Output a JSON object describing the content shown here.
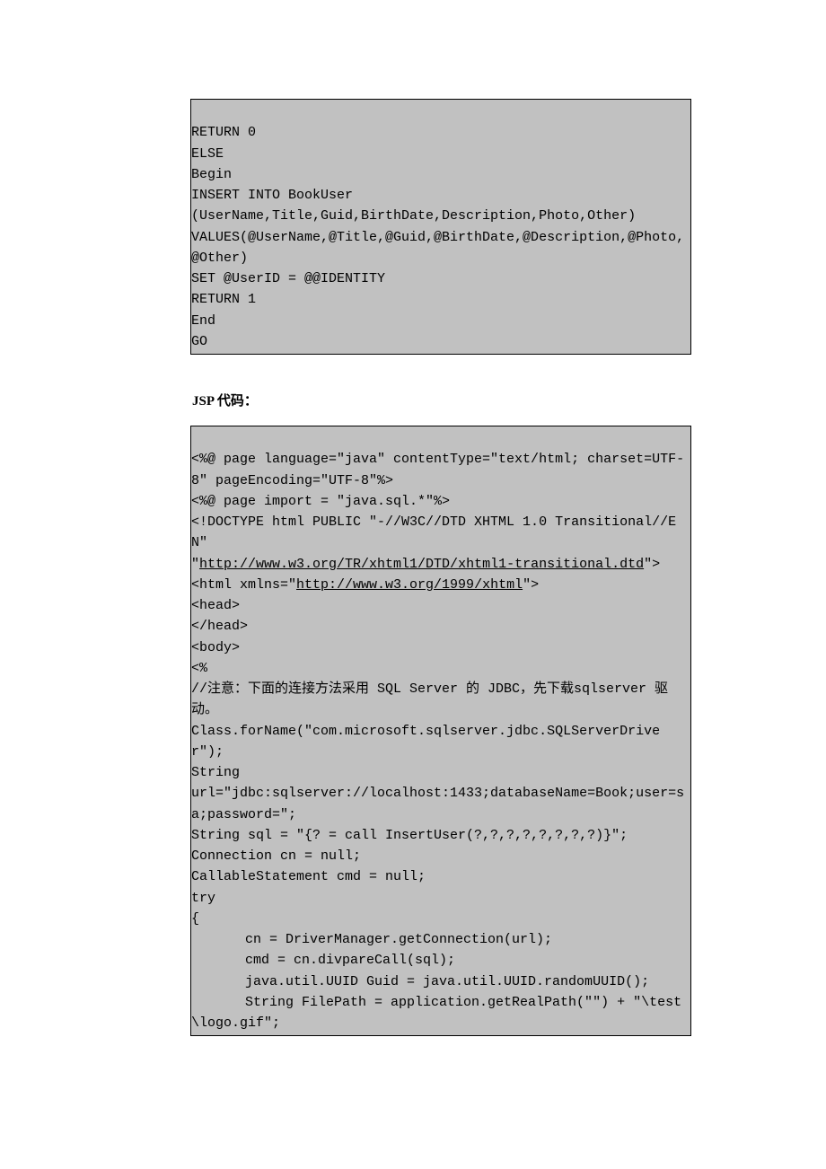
{
  "block1": {
    "l1": "RETURN 0",
    "l2": "ELSE",
    "l3": "Begin",
    "l4": "INSERT INTO BookUser",
    "l5": "(UserName,Title,Guid,BirthDate,Description,Photo,Other)",
    "l6": "VALUES(@UserName,@Title,@Guid,@BirthDate,@Description,@Photo,@Other)",
    "l7": "SET @UserID = @@IDENTITY",
    "l8": "RETURN 1",
    "l9": "End",
    "l10": "GO"
  },
  "headingText": "JSP 代码：",
  "block2": {
    "l1": "<%@ page language=\"java\" contentType=\"text/html; charset=UTF-8\" pageEncoding=\"UTF-8\"%>",
    "l2": "<%@ page import = \"java.sql.*\"%>",
    "l3a": "<!DOCTYPE html PUBLIC \"-//W3C//DTD XHTML 1.0 Transitional//EN\"",
    "l3b_pre": "\"",
    "l3b_link": "http://www.w3.org/TR/xhtml1/DTD/xhtml1-transitional.dtd",
    "l3b_post": "\">",
    "l4_pre": "<html xmlns=\"",
    "l4_link": "http://www.w3.org/1999/xhtml",
    "l4_post": "\">",
    "l5": "<head>",
    "l6": "</head>",
    "l7": "<body>",
    "l8": "<%",
    "l9": "//注意：下面的连接方法采用 SQL Server 的 JDBC，先下载sqlserver 驱动。",
    "l10": "Class.forName(\"com.microsoft.sqlserver.jdbc.SQLServerDriver\");",
    "l11": "String",
    "l12": "url=\"jdbc:sqlserver://localhost:1433;databaseName=Book;user=sa;password=\";",
    "l13": "String sql = \"{? = call InsertUser(?,?,?,?,?,?,?,?)}\";",
    "l14": "Connection cn = null;",
    "l15": "CallableStatement cmd = null;",
    "l16": "try",
    "l17": "{",
    "l18": "cn = DriverManager.getConnection(url);",
    "l19": "cmd = cn.divpareCall(sql);",
    "l20": "java.util.UUID Guid = java.util.UUID.randomUUID();",
    "l21": "String FilePath = application.getRealPath(\"\") + \"\\test\\logo.gif\";"
  }
}
